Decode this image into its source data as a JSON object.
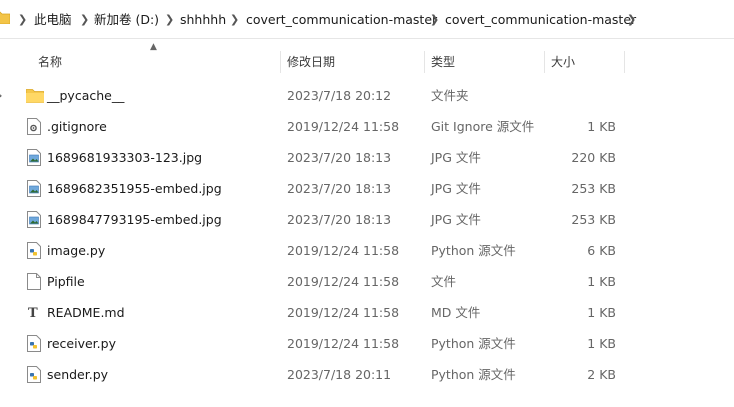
{
  "breadcrumb": [
    "此电脑",
    "新加卷 (D:)",
    "shhhhh",
    "covert_communication-master",
    "covert_communication-master"
  ],
  "columns": {
    "name": "名称",
    "date": "修改日期",
    "type": "类型",
    "size": "大小"
  },
  "files": [
    {
      "name": "__pycache__",
      "date": "2023/7/18 20:12",
      "type": "文件夹",
      "size": "",
      "icon": "folder-icon"
    },
    {
      "name": ".gitignore",
      "date": "2019/12/24 11:58",
      "type": "Git Ignore 源文件",
      "size": "1 KB",
      "icon": "gear-file-icon"
    },
    {
      "name": "1689681933303-123.jpg",
      "date": "2023/7/20 18:13",
      "type": "JPG 文件",
      "size": "220 KB",
      "icon": "image-file-icon"
    },
    {
      "name": "1689682351955-embed.jpg",
      "date": "2023/7/20 18:13",
      "type": "JPG 文件",
      "size": "253 KB",
      "icon": "image-file-icon"
    },
    {
      "name": "1689847793195-embed.jpg",
      "date": "2023/7/20 18:13",
      "type": "JPG 文件",
      "size": "253 KB",
      "icon": "image-file-icon"
    },
    {
      "name": "image.py",
      "date": "2019/12/24 11:58",
      "type": "Python 源文件",
      "size": "6 KB",
      "icon": "python-file-icon"
    },
    {
      "name": "Pipfile",
      "date": "2019/12/24 11:58",
      "type": "文件",
      "size": "1 KB",
      "icon": "blank-file-icon"
    },
    {
      "name": "README.md",
      "date": "2019/12/24 11:58",
      "type": "MD 文件",
      "size": "1 KB",
      "icon": "text-file-icon"
    },
    {
      "name": "receiver.py",
      "date": "2019/12/24 11:58",
      "type": "Python 源文件",
      "size": "1 KB",
      "icon": "python-file-icon"
    },
    {
      "name": "sender.py",
      "date": "2023/7/18 20:11",
      "type": "Python 源文件",
      "size": "2 KB",
      "icon": "python-file-icon"
    }
  ]
}
